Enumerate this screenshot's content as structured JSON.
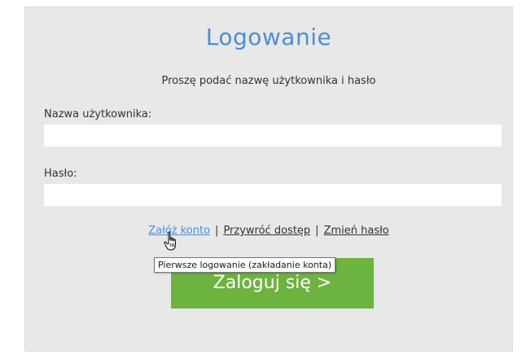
{
  "login": {
    "title": "Logowanie",
    "subtitle": "Proszę podać nazwę użytkownika i hasło",
    "username_label": "Nazwa użytkownika:",
    "username_value": "",
    "password_label": "Hasło:",
    "password_value": "",
    "links": {
      "create_account": "Załóż konto",
      "separator": "|",
      "restore_access": "Przywróć dostęp",
      "change_password": "Zmień hasło"
    },
    "login_button": "Zaloguj się >",
    "tooltip": "Pierwsze logowanie (zakładanie konta)"
  },
  "colors": {
    "panel_background": "#e8e8e8",
    "title": "#4a8fd6",
    "active_link": "#4a8fd6",
    "button_background": "#6db33f",
    "button_text": "#ffffff"
  },
  "icons": {
    "cursor": "hand-pointer-icon"
  }
}
